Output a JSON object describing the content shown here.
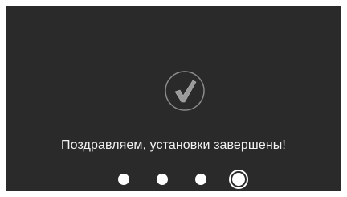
{
  "screen": {
    "icon": "checkmark-circle-icon",
    "message": "Поздравляем, установки завершены!",
    "pagination": {
      "total": 4,
      "current": 4
    },
    "colors": {
      "background": "#2a2a2a",
      "text": "#f2f2f2",
      "dot": "#ffffff"
    }
  }
}
